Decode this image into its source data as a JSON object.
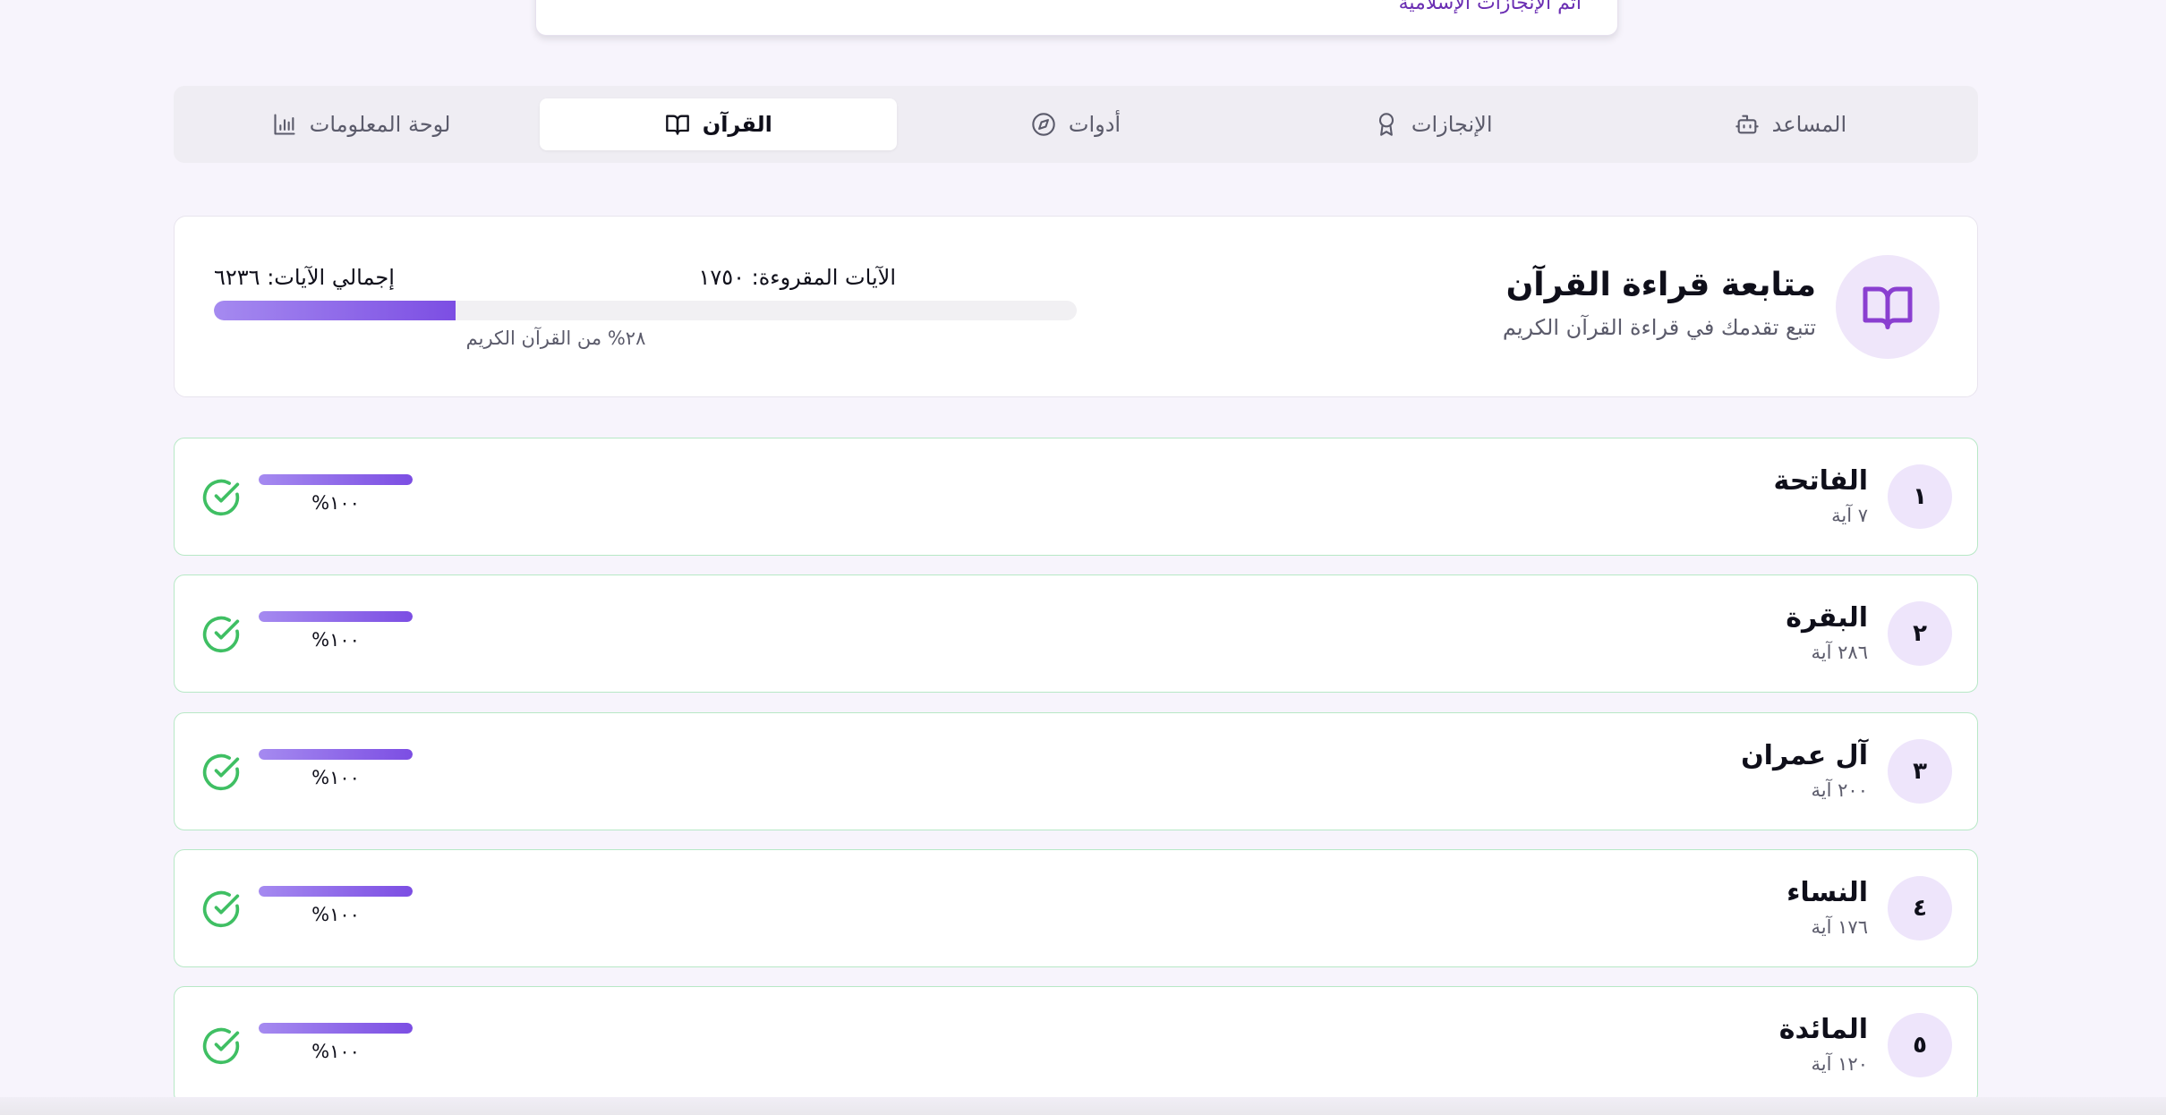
{
  "top_card": {
    "link_text": "اتم الإنجازات الإسلامية"
  },
  "tabs": [
    {
      "label": "المساعد",
      "icon": "bot-icon"
    },
    {
      "label": "الإنجازات",
      "icon": "award-icon"
    },
    {
      "label": "أدوات",
      "icon": "compass-icon"
    },
    {
      "label": "القرآن",
      "icon": "book-open-icon",
      "active": true
    },
    {
      "label": "لوحة المعلومات",
      "icon": "bar-chart-icon"
    }
  ],
  "summary": {
    "title": "متابعة قراءة القرآن",
    "subtitle": "تتبع تقدمك في قراءة القرآن الكريم",
    "read_label": "الآيات المقروءة: ١٧٥٠",
    "total_label": "إجمالي الآيات: ٦٢٣٦",
    "progress_fraction": 0.28,
    "percent_caption": "٢٨% من القرآن الكريم"
  },
  "surahs": [
    {
      "number": "١",
      "name": "الفاتحة",
      "ayat": "٧ آية",
      "percent": "١٠٠%",
      "progress": 1.0,
      "status": "complete"
    },
    {
      "number": "٢",
      "name": "البقرة",
      "ayat": "٢٨٦ آية",
      "percent": "١٠٠%",
      "progress": 1.0,
      "status": "complete"
    },
    {
      "number": "٣",
      "name": "آل عمران",
      "ayat": "٢٠٠ آية",
      "percent": "١٠٠%",
      "progress": 1.0,
      "status": "complete"
    },
    {
      "number": "٤",
      "name": "النساء",
      "ayat": "١٧٦ آية",
      "percent": "١٠٠%",
      "progress": 1.0,
      "status": "complete"
    },
    {
      "number": "٥",
      "name": "المائدة",
      "ayat": "١٢٠ آية",
      "percent": "١٠٠%",
      "progress": 1.0,
      "status": "complete"
    }
  ],
  "colors": {
    "accent": "#7c4ee3",
    "accent_light": "#efe6fa",
    "complete_green": "#3fbf63",
    "complete_border": "#b7e8c6"
  }
}
